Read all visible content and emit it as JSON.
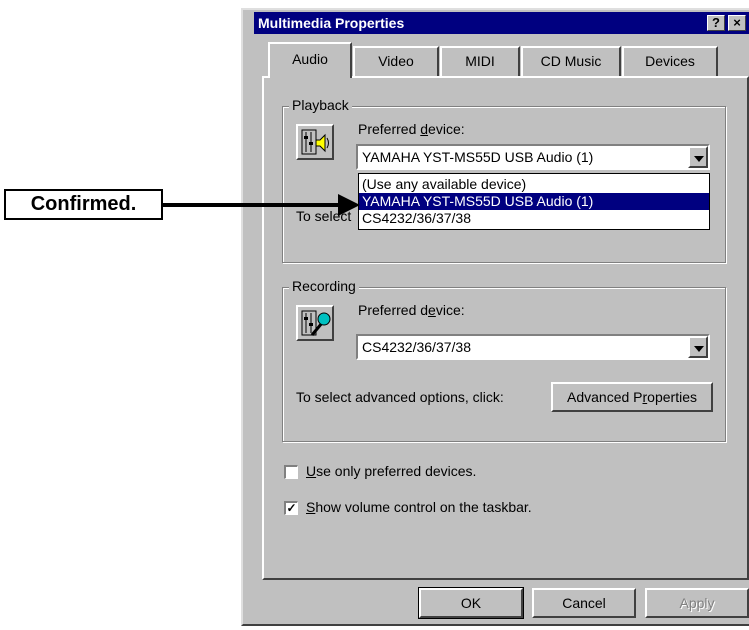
{
  "window": {
    "title": "Multimedia Properties",
    "help_btn": "?",
    "close_btn": "×"
  },
  "tabs": [
    {
      "label": "Audio",
      "active": true
    },
    {
      "label": "Video"
    },
    {
      "label": "MIDI"
    },
    {
      "label": "CD Music"
    },
    {
      "label": "Devices"
    }
  ],
  "playback": {
    "group_label": "Playback",
    "preferred_label_pre": "Preferred ",
    "preferred_label_key": "d",
    "preferred_label_post": "evice:",
    "selected": "YAMAHA YST-MS55D USB Audio (1)",
    "advanced_text": "To select",
    "options": [
      "(Use any available device)",
      "YAMAHA YST-MS55D USB Audio (1)",
      "CS4232/36/37/38"
    ],
    "selected_option_index": 1
  },
  "recording": {
    "group_label": "Recording",
    "preferred_label_pre": "Preferred d",
    "preferred_label_key": "e",
    "preferred_label_post": "vice:",
    "selected": "CS4232/36/37/38",
    "advanced_text": "To select advanced options, click:",
    "advanced_btn_pre": "Advanced P",
    "advanced_btn_key": "r",
    "advanced_btn_post": "operties"
  },
  "options": {
    "use_only_preferred_key": "U",
    "use_only_preferred_rest": "se only preferred devices.",
    "use_only_preferred_checked": false,
    "show_volume_key": "S",
    "show_volume_rest": "how volume control on the taskbar.",
    "show_volume_checked": true,
    "check_mark": "✓"
  },
  "buttons": {
    "ok": "OK",
    "cancel": "Cancel",
    "apply": "Apply"
  },
  "callout": {
    "text": "Confirmed."
  }
}
